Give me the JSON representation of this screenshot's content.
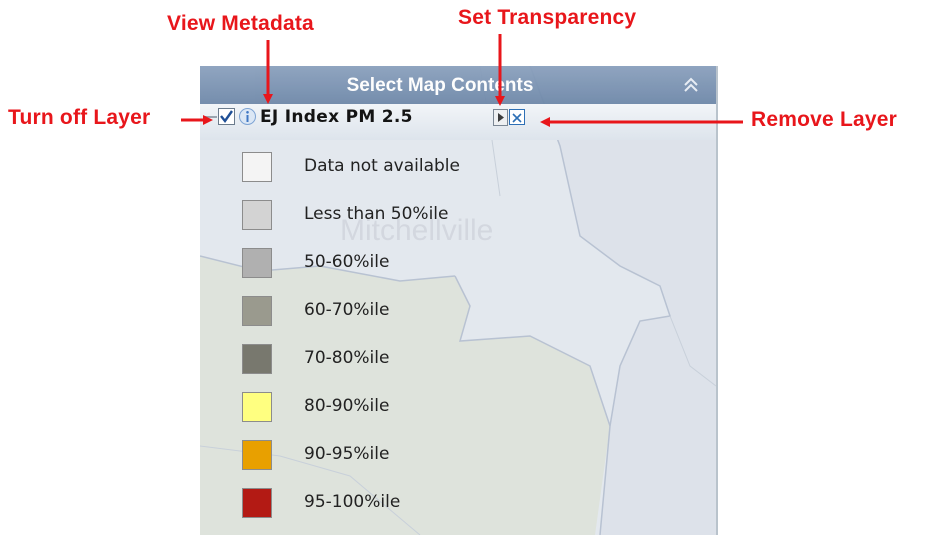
{
  "annotations": {
    "view_metadata": "View Metadata",
    "set_transparency": "Set Transparency",
    "turn_off_layer": "Turn off Layer",
    "remove_layer": "Remove Layer",
    "color": "#e8161b"
  },
  "panel": {
    "title": "Select Map Contents",
    "collapse_icon": "double-chevron-up-icon",
    "map_label": "Mitchellville",
    "layer": {
      "name": "EJ Index  PM 2.5",
      "checked": true,
      "info_icon": "info-icon",
      "transparency_icon": "play-arrow-icon",
      "remove_icon": "close-box-icon"
    },
    "legend": [
      {
        "label": "Data not available",
        "color": "#f4f4f4"
      },
      {
        "label": "Less than 50%ile",
        "color": "#d3d3d3"
      },
      {
        "label": "50-60%ile",
        "color": "#b0b0b0"
      },
      {
        "label": "60-70%ile",
        "color": "#9a9a8e"
      },
      {
        "label": "70-80%ile",
        "color": "#78786e"
      },
      {
        "label": "80-90%ile",
        "color": "#ffff80"
      },
      {
        "label": "90-95%ile",
        "color": "#e8a000"
      },
      {
        "label": "95-100%ile",
        "color": "#b31a14"
      }
    ]
  }
}
